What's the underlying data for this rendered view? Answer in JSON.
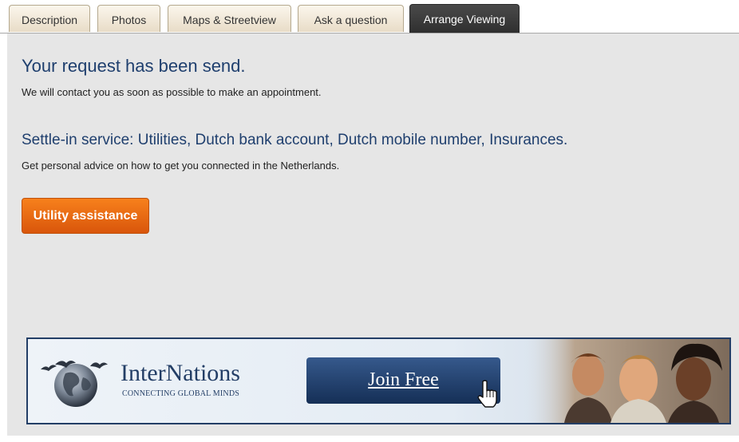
{
  "tabs": [
    {
      "label": "Description"
    },
    {
      "label": "Photos"
    },
    {
      "label": "Maps & Streetview"
    },
    {
      "label": "Ask a question"
    },
    {
      "label": "Arrange Viewing",
      "active": true
    }
  ],
  "main": {
    "title": "Your request has been send.",
    "subtitle": "We will contact you as soon as possible to make an appointment.",
    "service_title": "Settle-in service: Utilities, Dutch bank account, Dutch mobile number, Insurances.",
    "service_text": "Get personal advice on how to get you connected in the Netherlands.",
    "utility_button": "Utility assistance"
  },
  "banner": {
    "brand": "InterNations",
    "tagline": "CONNECTING GLOBAL MINDS",
    "cta": "Join Free"
  },
  "colors": {
    "heading": "#1f3f6e",
    "panel_bg": "#e6e6e6",
    "button_orange": "#e8680f",
    "banner_border": "#233e66",
    "active_tab": "#3a3a3a"
  }
}
